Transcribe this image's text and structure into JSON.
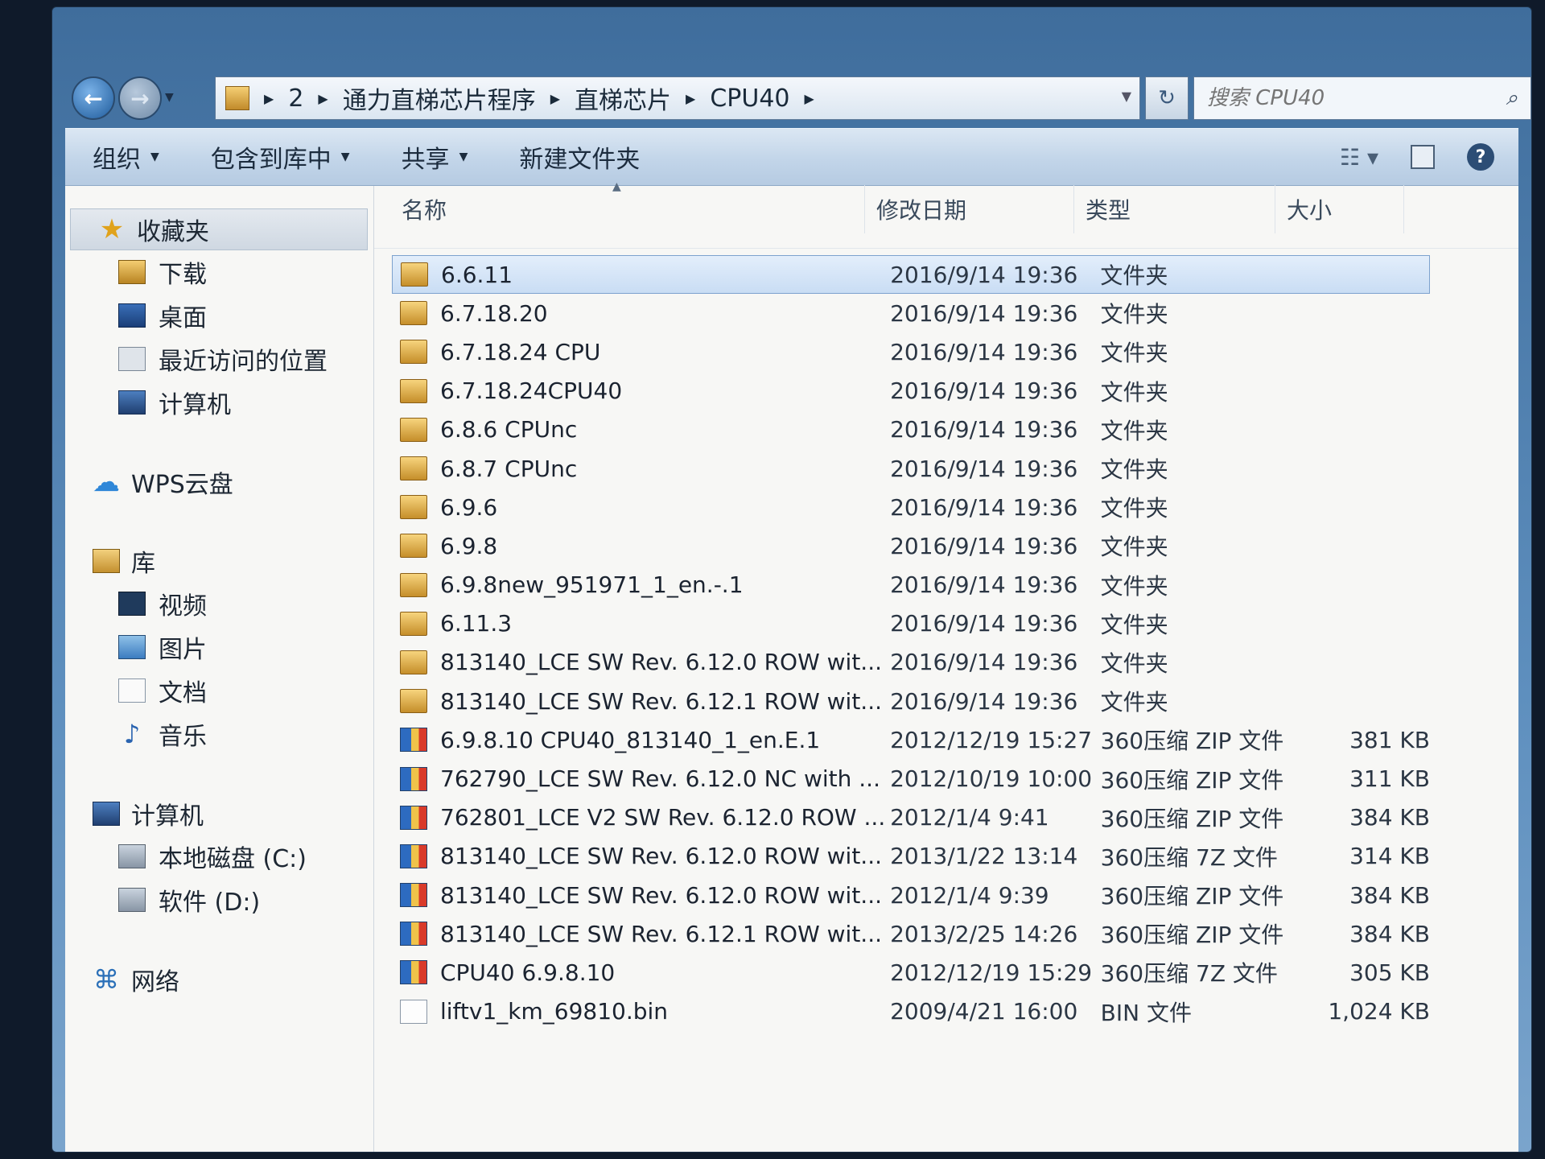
{
  "window": {
    "caption": {
      "minimize": "—",
      "maximize": "☐",
      "close": "✕"
    }
  },
  "address_bar": {
    "crumbs": [
      "2",
      "通力直梯芯片程序",
      "直梯芯片",
      "CPU40"
    ],
    "search_placeholder": "搜索 CPU40"
  },
  "toolbar": {
    "organize": "组织",
    "include_in_library": "包含到库中",
    "share": "共享",
    "new_folder": "新建文件夹"
  },
  "nav": {
    "favorites": {
      "label": "收藏夹",
      "items": [
        "下载",
        "桌面",
        "最近访问的位置",
        "计算机"
      ]
    },
    "cloud": {
      "label": "WPS云盘"
    },
    "libraries": {
      "label": "库",
      "items": [
        "视频",
        "图片",
        "文档",
        "音乐"
      ]
    },
    "computer": {
      "label": "计算机",
      "items": [
        "本地磁盘 (C:)",
        "软件 (D:)"
      ]
    },
    "network": {
      "label": "网络"
    }
  },
  "columns": {
    "name": "名称",
    "date": "修改日期",
    "type": "类型",
    "size": "大小"
  },
  "files": [
    {
      "icon": "folder",
      "name": "6.6.11",
      "date": "2016/9/14 19:36",
      "type": "文件夹",
      "size": "",
      "selected": true
    },
    {
      "icon": "folder",
      "name": "6.7.18.20",
      "date": "2016/9/14 19:36",
      "type": "文件夹",
      "size": ""
    },
    {
      "icon": "folder",
      "name": "6.7.18.24 CPU",
      "date": "2016/9/14 19:36",
      "type": "文件夹",
      "size": ""
    },
    {
      "icon": "folder",
      "name": "6.7.18.24CPU40",
      "date": "2016/9/14 19:36",
      "type": "文件夹",
      "size": ""
    },
    {
      "icon": "folder",
      "name": "6.8.6 CPUnc",
      "date": "2016/9/14 19:36",
      "type": "文件夹",
      "size": ""
    },
    {
      "icon": "folder",
      "name": "6.8.7 CPUnc",
      "date": "2016/9/14 19:36",
      "type": "文件夹",
      "size": ""
    },
    {
      "icon": "folder",
      "name": "6.9.6",
      "date": "2016/9/14 19:36",
      "type": "文件夹",
      "size": ""
    },
    {
      "icon": "folder",
      "name": "6.9.8",
      "date": "2016/9/14 19:36",
      "type": "文件夹",
      "size": ""
    },
    {
      "icon": "folder",
      "name": "6.9.8new_951971_1_en.-.1",
      "date": "2016/9/14 19:36",
      "type": "文件夹",
      "size": ""
    },
    {
      "icon": "folder",
      "name": "6.11.3",
      "date": "2016/9/14 19:36",
      "type": "文件夹",
      "size": ""
    },
    {
      "icon": "folder",
      "name": "813140_LCE SW Rev. 6.12.0 ROW wit...",
      "date": "2016/9/14 19:36",
      "type": "文件夹",
      "size": ""
    },
    {
      "icon": "folder",
      "name": "813140_LCE SW Rev. 6.12.1 ROW wit...",
      "date": "2016/9/14 19:36",
      "type": "文件夹",
      "size": ""
    },
    {
      "icon": "zip",
      "name": "6.9.8.10 CPU40_813140_1_en.E.1",
      "date": "2012/12/19 15:27",
      "type": "360压缩 ZIP 文件",
      "size": "381 KB"
    },
    {
      "icon": "zip",
      "name": "762790_LCE SW Rev. 6.12.0 NC with ...",
      "date": "2012/10/19 10:00",
      "type": "360压缩 ZIP 文件",
      "size": "311 KB"
    },
    {
      "icon": "zip",
      "name": "762801_LCE V2 SW Rev. 6.12.0 ROW ...",
      "date": "2012/1/4 9:41",
      "type": "360压缩 ZIP 文件",
      "size": "384 KB"
    },
    {
      "icon": "zip",
      "name": "813140_LCE SW Rev. 6.12.0 ROW wit...",
      "date": "2013/1/22 13:14",
      "type": "360压缩 7Z 文件",
      "size": "314 KB"
    },
    {
      "icon": "zip",
      "name": "813140_LCE SW Rev. 6.12.0 ROW wit...",
      "date": "2012/1/4 9:39",
      "type": "360压缩 ZIP 文件",
      "size": "384 KB"
    },
    {
      "icon": "zip",
      "name": "813140_LCE SW Rev. 6.12.1 ROW wit...",
      "date": "2013/2/25 14:26",
      "type": "360压缩 ZIP 文件",
      "size": "384 KB"
    },
    {
      "icon": "zip",
      "name": "CPU40 6.9.8.10",
      "date": "2012/12/19 15:29",
      "type": "360压缩 7Z 文件",
      "size": "305 KB"
    },
    {
      "icon": "bin",
      "name": "liftv1_km_69810.bin",
      "date": "2009/4/21 16:00",
      "type": "BIN 文件",
      "size": "1,024 KB"
    }
  ]
}
